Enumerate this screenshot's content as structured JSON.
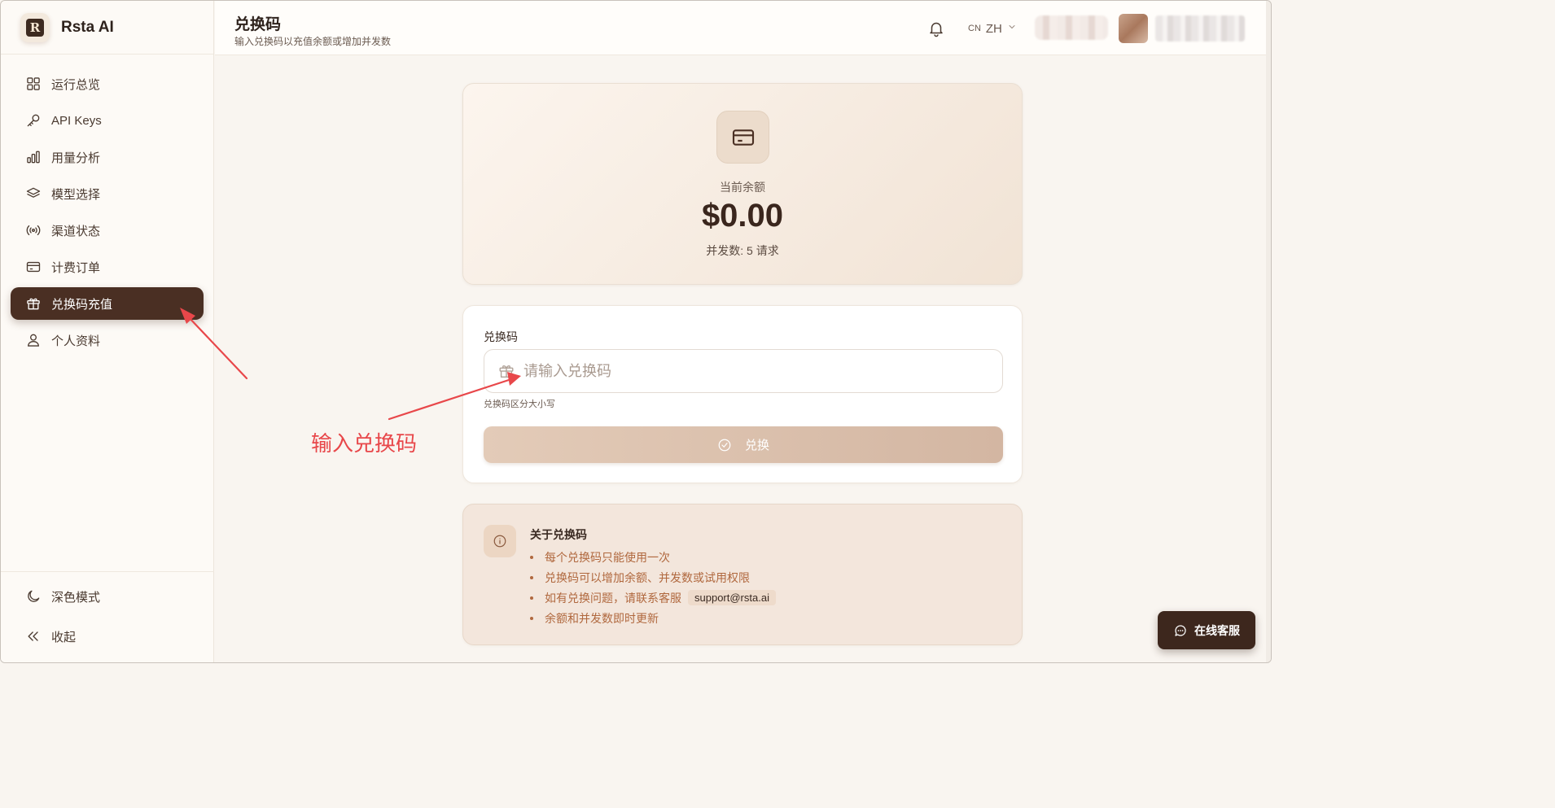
{
  "app": {
    "brand_name": "Rsta AI",
    "logo_letter": "R"
  },
  "sidebar": {
    "items": [
      {
        "label": "运行总览",
        "icon": "grid-icon"
      },
      {
        "label": "API Keys",
        "icon": "key-icon"
      },
      {
        "label": "用量分析",
        "icon": "bar-chart-icon"
      },
      {
        "label": "模型选择",
        "icon": "layers-icon"
      },
      {
        "label": "渠道状态",
        "icon": "broadcast-icon"
      },
      {
        "label": "计费订单",
        "icon": "credit-card-icon"
      },
      {
        "label": "兑换码充值",
        "icon": "gift-icon",
        "active": true
      },
      {
        "label": "个人资料",
        "icon": "user-icon"
      }
    ],
    "bottom": [
      {
        "label": "深色模式",
        "icon": "moon-icon"
      },
      {
        "label": "收起",
        "icon": "chevrons-left-icon"
      }
    ]
  },
  "header": {
    "title": "兑换码",
    "subtitle": "输入兑换码以充值余额或增加并发数",
    "lang_code": "CN",
    "lang_label": "ZH"
  },
  "balance": {
    "label": "当前余额",
    "value": "$0.00",
    "concurrency": "并发数: 5 请求"
  },
  "redeem": {
    "field_label": "兑换码",
    "placeholder": "请输入兑换码",
    "value": "",
    "hint": "兑换码区分大小写",
    "button_label": "兑换"
  },
  "info": {
    "title": "关于兑换码",
    "items": [
      "每个兑换码只能使用一次",
      "兑换码可以增加余额、并发数或试用权限",
      "如有兑换问题，请联系客服",
      "余额和并发数即时更新"
    ],
    "support_email": "support@rsta.ai"
  },
  "annotation": {
    "text": "输入兑换码"
  },
  "support_button": {
    "label": "在线客服"
  },
  "colors": {
    "accent_dark": "#4a2f23",
    "annotation_red": "#e8474a",
    "info_bullet": "#b0683e"
  }
}
